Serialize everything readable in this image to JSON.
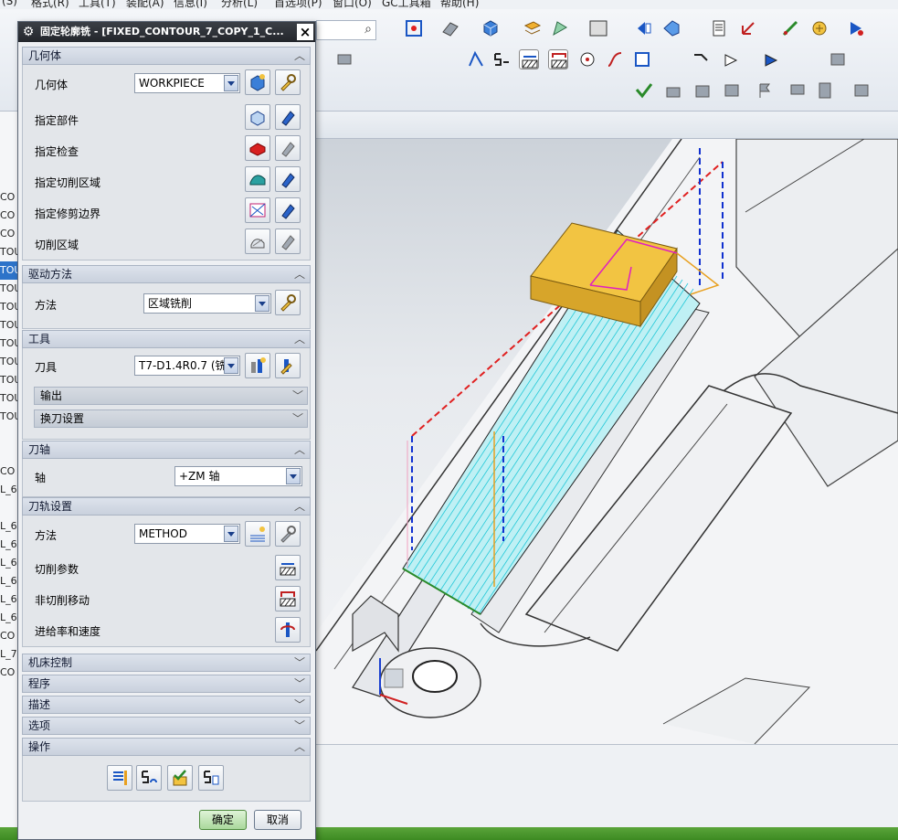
{
  "menu": [
    "(S)",
    "格式(R)",
    "工具(T)",
    "装配(A)",
    "信息(I)",
    "分析(L)",
    "首选项(P)",
    "窗口(O)",
    "GC工具箱",
    "帮助(H)"
  ],
  "nav_items": [
    "CO",
    "CO",
    "CO",
    "TOU",
    "TOU",
    "TOU",
    "TOU",
    "TOU",
    "TOU",
    "TOU",
    "TOU",
    "TOU",
    "TOU",
    "CO",
    "L_6",
    "L_6",
    "L_6",
    "L_6",
    "L_6",
    "L_6",
    "L_6",
    "CO",
    "L_7",
    "CO"
  ],
  "nav_selected_index": 4,
  "dialog": {
    "title": "固定轮廓铣 - [FIXED_CONTOUR_7_COPY_1_C...",
    "close": "×",
    "geometry": {
      "header": "几何体",
      "geometry_label": "几何体",
      "geometry_value": "WORKPIECE",
      "specify_part": "指定部件",
      "specify_check": "指定检查",
      "specify_cut_area": "指定切削区域",
      "specify_trim": "指定修剪边界",
      "cut_region": "切削区域"
    },
    "drive": {
      "header": "驱动方法",
      "method_label": "方法",
      "method_value": "区域铣削"
    },
    "tool": {
      "header": "工具",
      "tool_label": "刀具",
      "tool_value": "T7-D1.4R0.7 (铣",
      "output": "输出",
      "tool_change": "换刀设置"
    },
    "axis": {
      "header": "刀轴",
      "axis_label": "轴",
      "axis_value": "+ZM 轴"
    },
    "path": {
      "header": "刀轨设置",
      "method_label": "方法",
      "method_value": "METHOD",
      "cut_params": "切削参数",
      "non_cut": "非切削移动",
      "feeds": "进给率和速度"
    },
    "machine_control": "机床控制",
    "program": "程序",
    "description": "描述",
    "options": "选项",
    "actions": "操作",
    "ok": "确定",
    "cancel": "取消"
  },
  "colors": {
    "toolpath": "#22c8d8",
    "block": "#e8b83a",
    "rapid_red": "#e02020",
    "rapid_blue": "#1030d0",
    "accent": "#2d73c9"
  }
}
